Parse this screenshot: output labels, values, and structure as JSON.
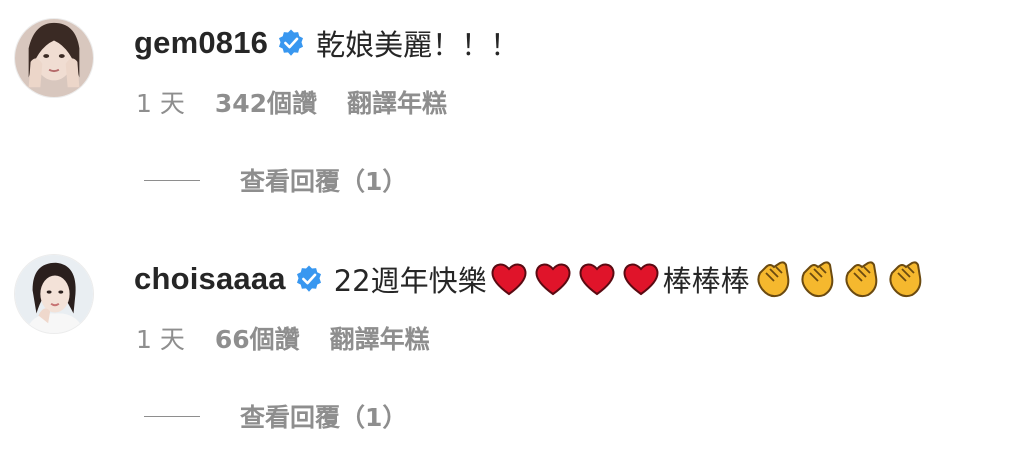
{
  "comments": [
    {
      "username": "gem0816",
      "text": "乾娘美麗！！！",
      "time": "1 天",
      "likes": "342個讚",
      "translate": "翻譯年糕",
      "view_replies": "查看回覆（1）",
      "avatar": "avatar-woman-hands-face"
    },
    {
      "username": "choisaaaa",
      "text_part1": "22週年快樂",
      "text_part2": "棒棒棒",
      "emoji_1": "red-heart-icon",
      "emoji_2": "clapping-hands-icon",
      "time": "1 天",
      "likes": "66個讚",
      "translate": "翻譯年糕",
      "view_replies": "查看回覆（1）",
      "avatar": "avatar-woman-dark-hair"
    }
  ],
  "colors": {
    "text": "#262626",
    "secondary": "#8e8e8e",
    "verified": "#3897f0",
    "heart": "#e0142a",
    "clap": "#f5b82e"
  }
}
